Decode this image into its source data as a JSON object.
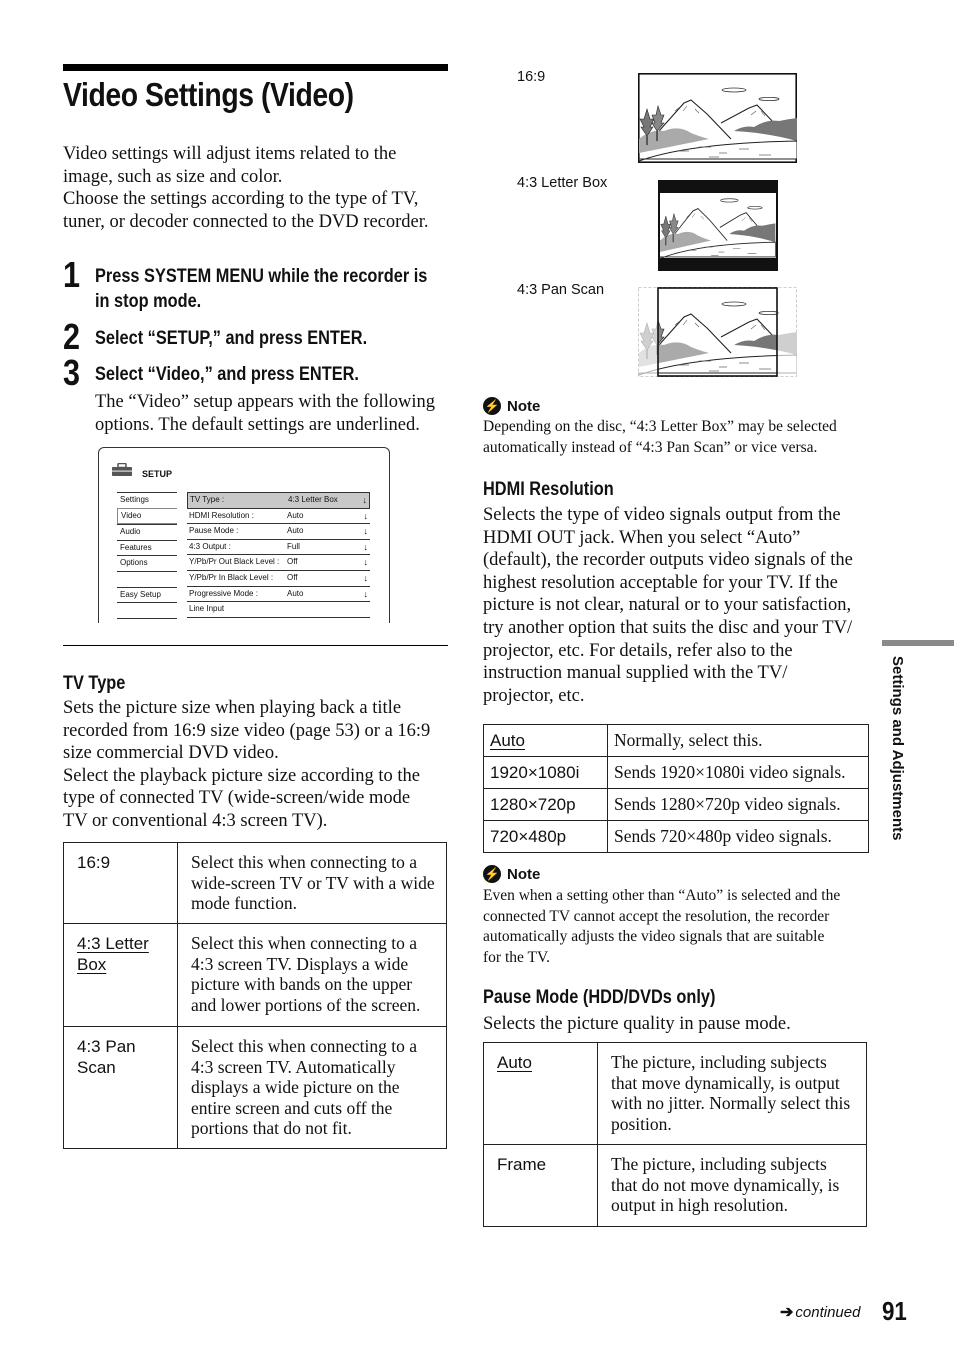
{
  "page": {
    "title": "Video Settings (Video)",
    "intro": "Video settings will adjust items related to the image, such as size and color. Choose the settings according to the type of TV, tuner, or decoder connected to the DVD recorder.",
    "intro_lines": [
      "Video settings will adjust items related to the",
      "image, such as size and color.",
      "Choose the settings according to the type of TV,",
      "tuner, or decoder connected to the DVD recorder."
    ]
  },
  "steps": [
    {
      "number": "1",
      "lines": [
        "Press SYSTEM MENU while the recorder is",
        "in stop mode."
      ]
    },
    {
      "number": "2",
      "lines": [
        "Select “SETUP,” and press ENTER."
      ]
    },
    {
      "number": "3",
      "lines": [
        "Select “Video,” and press ENTER."
      ]
    }
  ],
  "step3_description": [
    "The “Video” setup appears with the following",
    "options. The default settings are underlined."
  ],
  "osd": {
    "title": "SETUP",
    "icon": "toolbox-icon",
    "menu": [
      "Settings",
      "Video",
      "Audio",
      "Features",
      "Options",
      "",
      "Easy Setup",
      ""
    ],
    "selected_menu": "Video",
    "rows": [
      {
        "label": "TV Type :",
        "value": "4:3 Letter Box",
        "arrow": "↓"
      },
      {
        "label": "HDMI Resolution :",
        "value": "Auto",
        "arrow": "↓"
      },
      {
        "label": "Pause Mode :",
        "value": "Auto",
        "arrow": "↓"
      },
      {
        "label": "4:3 Output :",
        "value": "Full",
        "arrow": "↓"
      },
      {
        "label": "Y/Pb/Pr Out Black Level :",
        "value": "Off",
        "arrow": "↓"
      },
      {
        "label": "Y/Pb/Pr In Black Level :",
        "value": "Off",
        "arrow": "↓"
      },
      {
        "label": "Progressive Mode :",
        "value": "Auto",
        "arrow": "↓"
      },
      {
        "label": "Line Input",
        "value": "",
        "arrow": ""
      }
    ]
  },
  "tv_type": {
    "heading": "TV Type",
    "body_lines": [
      "Sets the picture size when playing back a title",
      "recorded from 16:9 size video (page 53) or a 16:9",
      "size commercial DVD video.",
      "Select the playback picture size according to the",
      "type of connected TV (wide-screen/wide mode",
      "TV or conventional 4:3 screen TV)."
    ],
    "options": [
      {
        "key_lines": [
          "16:9"
        ],
        "default": false,
        "desc_lines": [
          "Select this when connecting to a",
          "wide-screen TV or TV with a wide",
          "mode function."
        ]
      },
      {
        "key_lines": [
          "4:3 Letter",
          "Box"
        ],
        "default": true,
        "desc_lines": [
          "Select this when connecting to a",
          "4:3 screen TV. Displays a wide",
          "picture with bands on the upper",
          "and lower portions of the screen."
        ]
      },
      {
        "key_lines": [
          "4:3 Pan",
          "Scan"
        ],
        "default": false,
        "desc_lines": [
          "Select this when connecting to a",
          "4:3 screen TV. Automatically",
          "displays a wide picture on the",
          "entire screen and cuts off the",
          "portions that do not fit."
        ]
      }
    ]
  },
  "illustrations": [
    {
      "label": "16:9",
      "icon": "widescreen-landscape-icon"
    },
    {
      "label": "4:3 Letter Box",
      "icon": "letterbox-landscape-icon"
    },
    {
      "label": "4:3 Pan Scan",
      "icon": "panscan-landscape-icon"
    }
  ],
  "note1": {
    "label": "Note",
    "lines": [
      "Depending on the disc, “4:3 Letter Box” may be selected",
      "automatically instead of “4:3 Pan Scan” or vice versa."
    ]
  },
  "hdmi": {
    "heading": "HDMI Resolution",
    "body_lines": [
      "Selects the type of video signals output from the",
      "HDMI OUT jack. When you select “Auto”",
      "(default), the recorder outputs video signals of the",
      "highest resolution acceptable for your TV. If the",
      "picture is not clear, natural or to your satisfaction,",
      "try another option that suits the disc and your TV/",
      "projector, etc. For details, refer also to the",
      "instruction manual supplied with the TV/",
      "projector, etc."
    ],
    "options": [
      {
        "key": "Auto",
        "default": true,
        "desc": "Normally, select this."
      },
      {
        "key": "1920×1080i",
        "default": false,
        "desc": "Sends 1920×1080i video signals."
      },
      {
        "key": "1280×720p",
        "default": false,
        "desc": "Sends 1280×720p video signals."
      },
      {
        "key": "720×480p",
        "default": false,
        "desc": "Sends 720×480p video signals."
      }
    ]
  },
  "note2": {
    "label": "Note",
    "lines": [
      "Even when a setting other than “Auto” is selected and the",
      "connected TV cannot accept the resolution, the recorder",
      "automatically adjusts the video signals that are suitable",
      "for the TV."
    ]
  },
  "pause_mode": {
    "heading": "Pause Mode (HDD/DVDs only)",
    "body": "Selects the picture quality in pause mode.",
    "options": [
      {
        "key": "Auto",
        "default": true,
        "desc_lines": [
          "The picture, including subjects",
          "that move dynamically, is output",
          "with no jitter. Normally select this",
          "position."
        ]
      },
      {
        "key": "Frame",
        "default": false,
        "desc_lines": [
          "The picture, including subjects",
          "that do not move dynamically, is",
          "output in high resolution."
        ]
      }
    ]
  },
  "side_tab": {
    "label": "Settings and Adjustments"
  },
  "footer": {
    "continued": "continued",
    "page_number": "91"
  }
}
